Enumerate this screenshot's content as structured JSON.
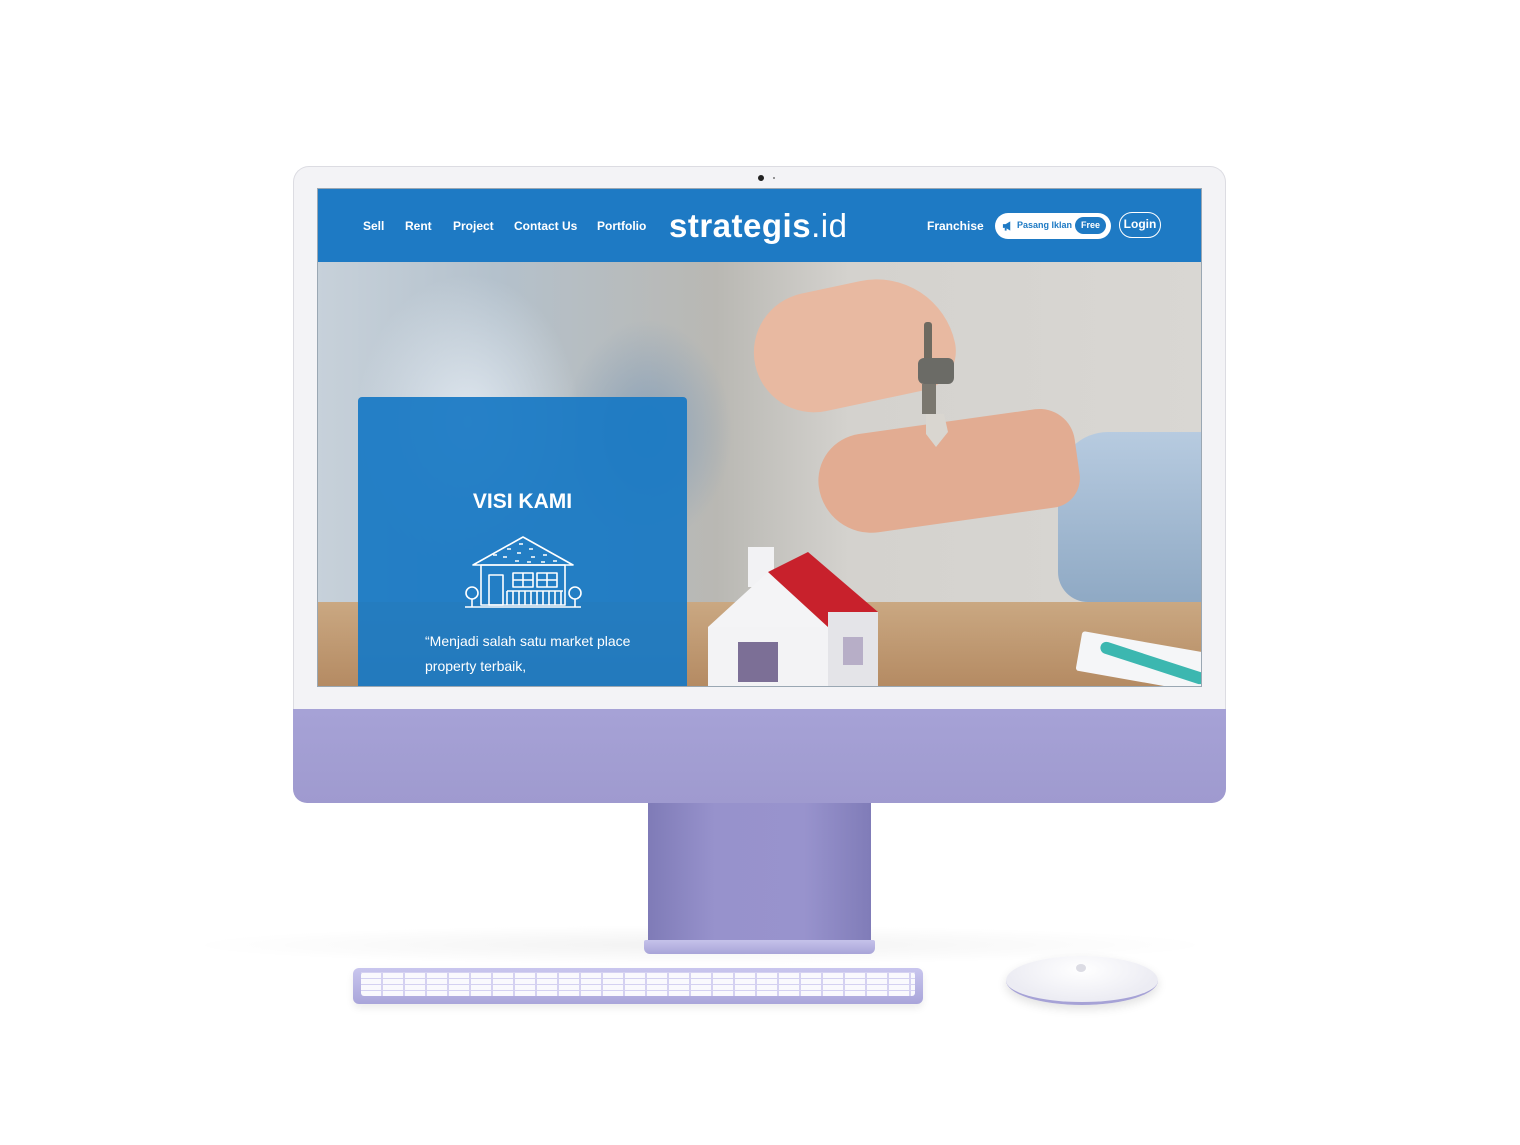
{
  "nav": {
    "links": [
      "Sell",
      "Rent",
      "Project",
      "Contact Us",
      "Portfolio"
    ],
    "logo": "strategis",
    "logo_tld": ".id",
    "franchise": "Franchise",
    "pasang_label": "Pasang Iklan",
    "free_badge": "Free",
    "login": "Login"
  },
  "hero": {
    "card_title": "VISI KAMI",
    "quote": "“Menjadi salah satu market place property terbaik,"
  },
  "colors": {
    "brand_blue": "#1e7ac4",
    "monitor_purple": "#a6a2d6"
  },
  "icons": {
    "pasang": "megaphone-icon",
    "visi": "house-icon"
  }
}
